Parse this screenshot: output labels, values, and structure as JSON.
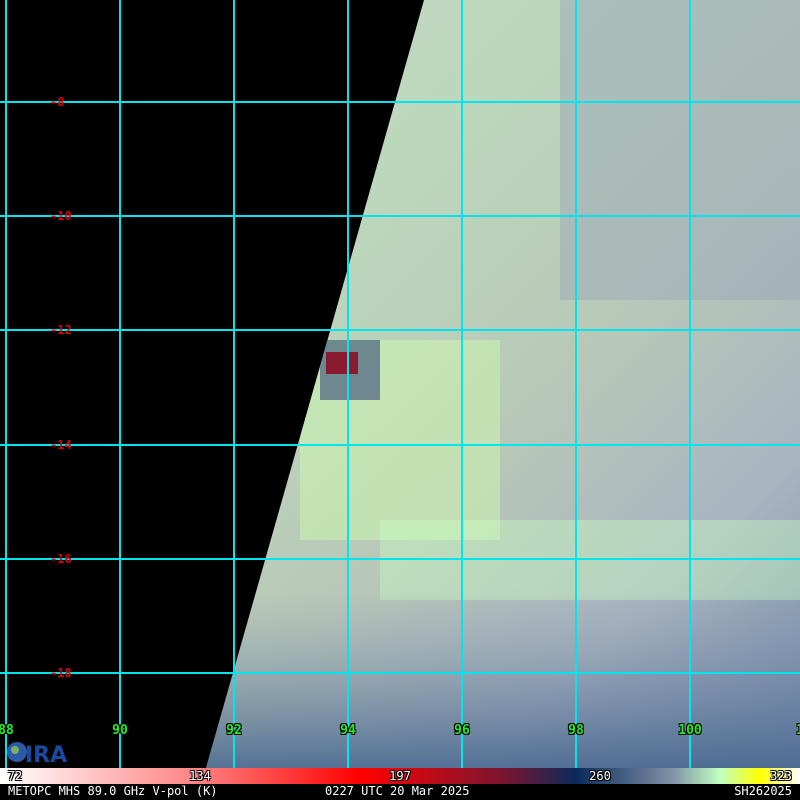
{
  "map": {
    "latitudes": [
      "-8",
      "-10",
      "-12",
      "-14",
      "-16",
      "-18"
    ],
    "longitudes": [
      "88",
      "90",
      "92",
      "94",
      "96",
      "98",
      "100",
      "1"
    ],
    "grid_color": "#00e5ee"
  },
  "logo": {
    "text": "CIRA"
  },
  "colorbar": {
    "ticks": [
      "72",
      "134",
      "197",
      "260",
      "323"
    ]
  },
  "footer": {
    "product": "METOPC MHS 89.0 GHz V-pol (K)",
    "time": "0227 UTC 20 Mar 2025",
    "storm_id": "SH262025"
  }
}
